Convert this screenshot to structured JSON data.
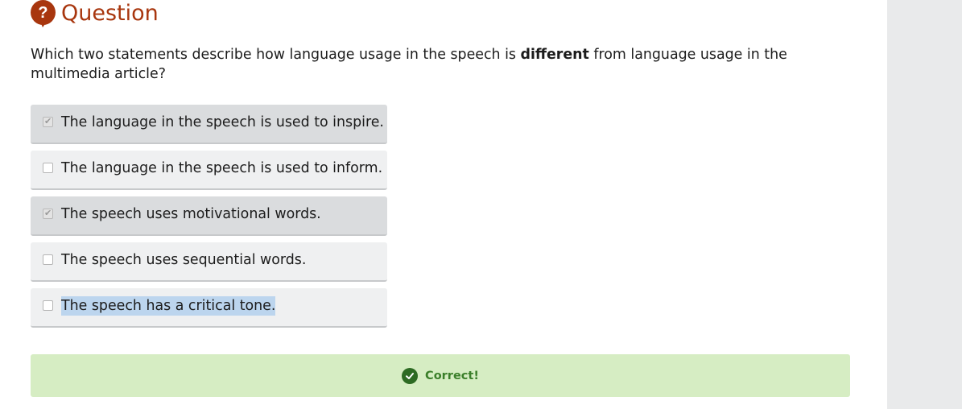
{
  "header": {
    "icon": "question-icon",
    "title": "Question",
    "accent_color": "#a8360e"
  },
  "prompt": {
    "before": "Which two statements describe how language usage in the speech is ",
    "emphasis": "different",
    "after": " from language usage in the multimedia article?"
  },
  "options": [
    {
      "label": "The language in the speech is used to inspire.",
      "checked": true
    },
    {
      "label": "The language in the speech is used to inform.",
      "checked": false
    },
    {
      "label": "The speech uses motivational words.",
      "checked": true
    },
    {
      "label": "The speech uses sequential words.",
      "checked": false
    },
    {
      "label": "The speech has a critical tone.",
      "checked": false,
      "text_selected": true
    }
  ],
  "feedback": {
    "icon": "checkmark-circle-icon",
    "text": "Correct!",
    "status_color": "#3b7f2a",
    "background": "#d6edc3"
  }
}
